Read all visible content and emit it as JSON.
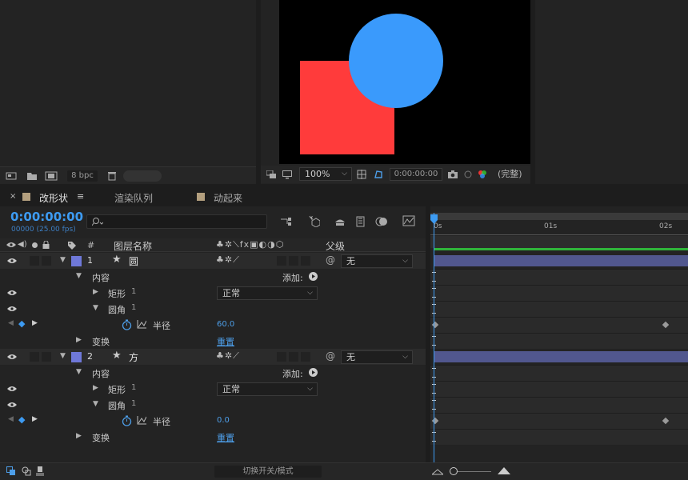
{
  "colors": {
    "accent": "#4d9ee8",
    "label_blue": "#6f78d8",
    "layer_bar": "#51578e",
    "work_green": "#2fb53a",
    "comp_red": "#ff3b3b",
    "comp_blue": "#3a9afc"
  },
  "project_panel": {
    "bpc": "8 bpc"
  },
  "viewer": {
    "zoom": "100%",
    "timecode": "0:00:00:00",
    "resolution": "(完整)"
  },
  "tabs": [
    {
      "label": "改形状",
      "active": true
    },
    {
      "label": "渲染队列",
      "active": false
    },
    {
      "label": "动起来",
      "active": false
    }
  ],
  "timeline": {
    "current_time": "0:00:00:00",
    "frame_info": "00000 (25.00 fps)",
    "search_placeholder": "",
    "col_hash": "#",
    "col_layer_name": "图层名称",
    "col_parent": "父级",
    "ruler": [
      "0s",
      "01s",
      "02s"
    ],
    "toggle_label": "切换开关/模式"
  },
  "layers": [
    {
      "index": "1",
      "name": "圆",
      "parent": "无",
      "contents_label": "内容",
      "add_label": "添加:",
      "rect_label": "矩形",
      "rect_num": "1",
      "blend_mode": "正常",
      "round_label": "圆角",
      "round_num": "1",
      "radius_label": "半径",
      "radius_value": "60.0",
      "transform_label": "变换",
      "reset_label": "重置"
    },
    {
      "index": "2",
      "name": "方",
      "parent": "无",
      "contents_label": "内容",
      "add_label": "添加:",
      "rect_label": "矩形",
      "rect_num": "1",
      "blend_mode": "正常",
      "round_label": "圆角",
      "round_num": "1",
      "radius_label": "半径",
      "radius_value": "0.0",
      "transform_label": "变换",
      "reset_label": "重置"
    }
  ]
}
